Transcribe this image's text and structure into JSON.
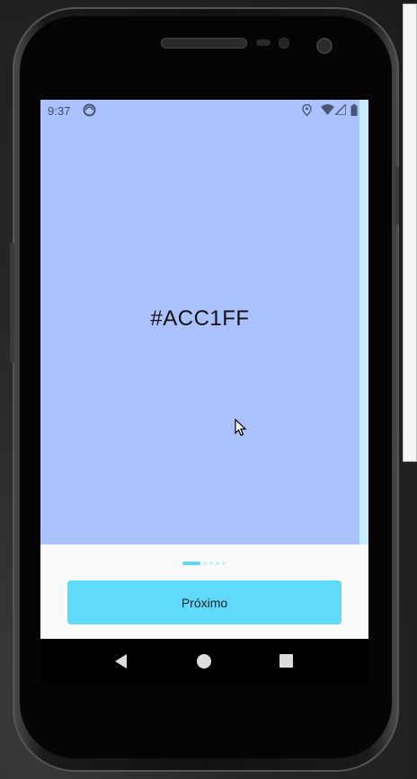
{
  "status_bar": {
    "time": "9:37",
    "icons": [
      "sync-icon",
      "location-icon",
      "wifi-icon",
      "signal-icon",
      "battery-icon"
    ]
  },
  "page": {
    "title": "#ACC1FF",
    "background": "#acc1ff",
    "next_page_background": "#c6ecff"
  },
  "pager": {
    "total_pages": 5,
    "current_page": 1,
    "active_color": "#5ed8f7"
  },
  "actions": {
    "next_label": "Próximo",
    "next_color": "#5fdafa"
  },
  "navigation": {
    "buttons": [
      "back-icon",
      "home-icon",
      "recents-icon"
    ]
  }
}
